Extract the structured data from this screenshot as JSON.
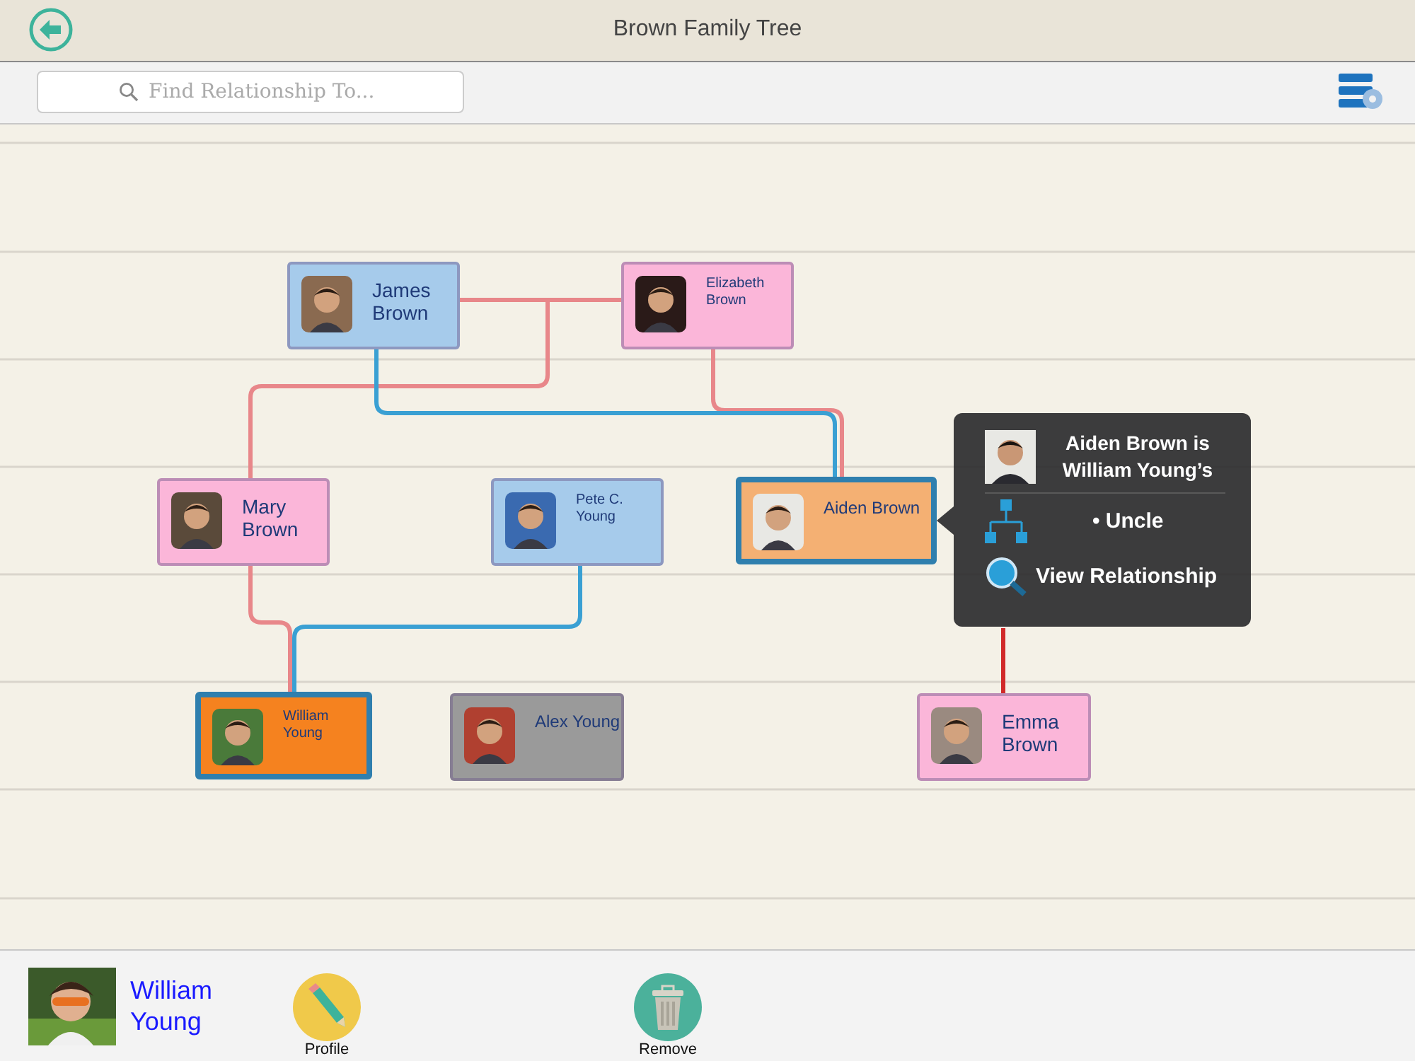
{
  "header": {
    "title": "Brown Family Tree"
  },
  "search": {
    "placeholder": "Find Relationship To..."
  },
  "tree": {
    "nodes": [
      {
        "name": "James Brown",
        "color": "#a6cbeb",
        "highlighted": false
      },
      {
        "name": "Elizabeth Brown",
        "color": "#fbb6d9",
        "highlighted": false
      },
      {
        "name": "Mary Brown",
        "color": "#fbb6d9",
        "highlighted": false
      },
      {
        "name": "Pete C. Young",
        "color": "#a6cbeb",
        "highlighted": false
      },
      {
        "name": "Aiden Brown",
        "color": "#f4b073",
        "highlighted": true
      },
      {
        "name": "William Young",
        "color": "#f5821f",
        "highlighted": true
      },
      {
        "name": "Alex Young",
        "color": "#9a9a9a",
        "highlighted": false
      },
      {
        "name": "Emma Brown",
        "color": "#fbb6d9",
        "highlighted": false
      }
    ],
    "popover": {
      "title": "Aiden Brown is William Young’s",
      "relation": "• Uncle",
      "action": "View Relationship"
    }
  },
  "footer": {
    "name": "William Young",
    "buttons": [
      {
        "kind": "edit",
        "label": "Profile"
      },
      {
        "kind": "delete",
        "label": "Remove"
      }
    ]
  }
}
